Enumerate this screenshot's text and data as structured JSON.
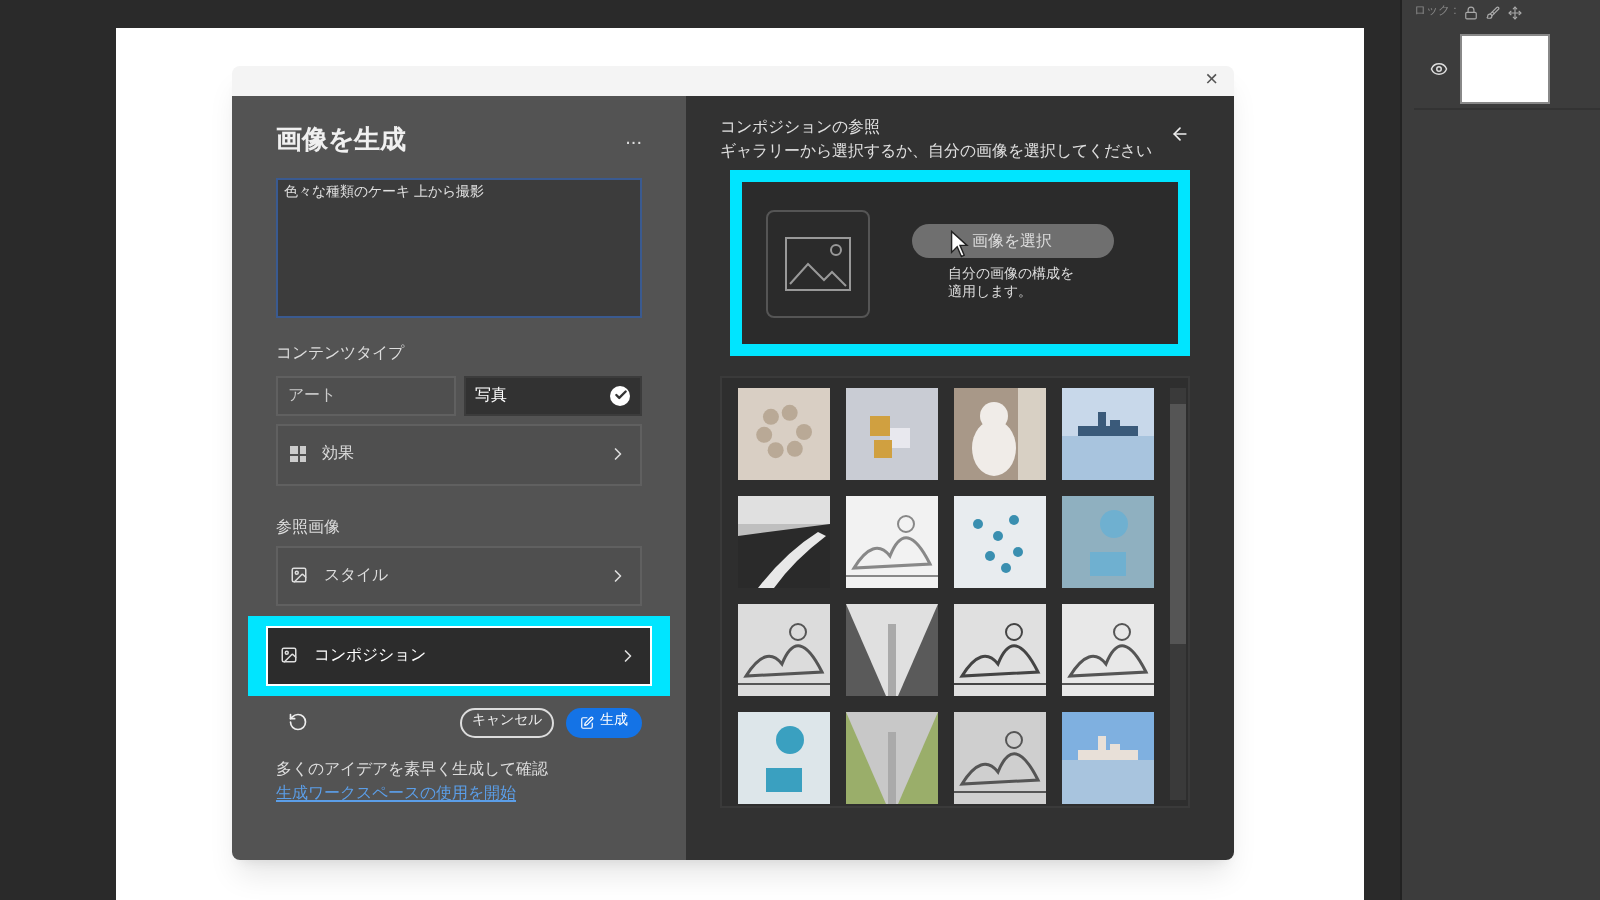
{
  "layers_panel": {
    "label": "ロック :"
  },
  "dialog": {
    "close": "×"
  },
  "left": {
    "title": "画像を生成",
    "more": "...",
    "prompt": "色々な種類のケーキ 上から撮影",
    "content_type": {
      "label": "コンテンツタイプ",
      "options": [
        {
          "label": "アート",
          "selected": false
        },
        {
          "label": "写真",
          "selected": true
        }
      ]
    },
    "effects": {
      "label": "効果"
    },
    "reference": {
      "label": "参照画像",
      "items": [
        {
          "label": "スタイル",
          "highlighted": false
        },
        {
          "label": "コンポジション",
          "highlighted": true
        }
      ]
    },
    "cancel": "キャンセル",
    "generate": "生成",
    "tip": "多くのアイデアを素早く生成して確認",
    "link": "生成ワークスペースの使用を開始"
  },
  "right": {
    "title": "コンポジションの参照",
    "subtitle": "ギャラリーから選択するか、自分の画像を選択してください",
    "choose_button": "画像を選択",
    "choose_hint": "自分の画像の構成を適用します。",
    "highlighted": true
  }
}
